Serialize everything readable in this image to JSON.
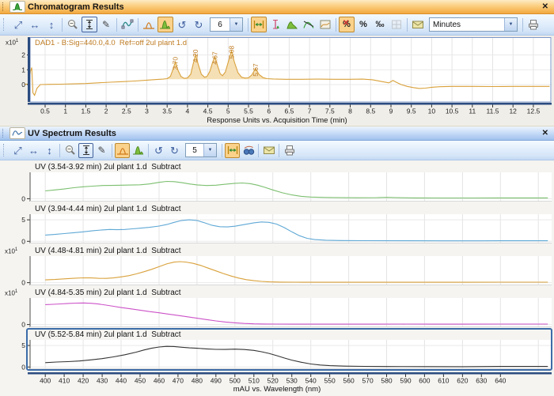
{
  "icons": {
    "expand_diag": "⤢",
    "expand_h": "↔",
    "expand_v": "↕",
    "undo": "↺",
    "redo": "↻",
    "dropdown_arrow": "▼",
    "close": "✕",
    "brush": "✎",
    "percent": "%",
    "cross": "✕",
    "permille": "‰"
  },
  "chromatogram_panel": {
    "title": "Chromatogram Results",
    "toolbar": {
      "zoom_value": "6",
      "unit_value": "Minutes"
    },
    "signal_label": "DAD1 - B:Sig=440.0,4.0  Ref=off 2ul plant 1.d",
    "y_exp_base": "x10",
    "y_exp_sup": "1",
    "axis_title": "Response Units vs. Acquisition Time (min)"
  },
  "uv_panel": {
    "title": "UV Spectrum Results",
    "toolbar": {
      "zoom_value": "5"
    },
    "y_exp_base": "x10",
    "y_exp_sup": "1",
    "axis_title": "mAU vs. Wavelength (nm)"
  },
  "chart_data": [
    {
      "id": "chrom",
      "type": "line",
      "title": "DAD1 - B:Sig=440.0,4.0  Ref=off 2ul plant 1.d",
      "xlabel": "Response Units vs. Acquisition Time (min)",
      "color": "#D9A13B",
      "fill_color": "#F5DFB5",
      "fill_range": [
        3.5,
        5.95
      ],
      "fill_base": 0.36,
      "xlim": [
        0.13,
        12.95
      ],
      "ylim": [
        -1.17,
        3.2
      ],
      "yticks": [
        0,
        1,
        2
      ],
      "xticks": {
        "start": 0.5,
        "end": 12.5,
        "step": 0.5
      },
      "frame": "chrom",
      "axis_strip": true,
      "peaks": [
        {
          "t": 3.7,
          "apex": 1.52,
          "label": "3.70"
        },
        {
          "t": 4.2,
          "apex": 2.02,
          "label": "4.20"
        },
        {
          "t": 4.67,
          "apex": 1.88,
          "label": "4.67"
        },
        {
          "t": 5.08,
          "apex": 2.28,
          "label": "5.08"
        },
        {
          "t": 5.67,
          "apex": 1.08,
          "label": "5.67"
        }
      ],
      "points": [
        [
          0.0,
          0.02
        ],
        [
          0.1,
          0.04
        ],
        [
          0.14,
          0.9
        ],
        [
          0.17,
          1.15
        ],
        [
          0.2,
          -0.55
        ],
        [
          0.24,
          -0.72
        ],
        [
          0.3,
          -0.25
        ],
        [
          0.38,
          0.0
        ],
        [
          0.6,
          0.02
        ],
        [
          0.9,
          0.03
        ],
        [
          1.2,
          0.05
        ],
        [
          1.5,
          0.07
        ],
        [
          1.8,
          0.12
        ],
        [
          2.1,
          0.16
        ],
        [
          2.4,
          0.2
        ],
        [
          2.7,
          0.24
        ],
        [
          3.0,
          0.3
        ],
        [
          3.2,
          0.34
        ],
        [
          3.4,
          0.37
        ],
        [
          3.5,
          0.4
        ],
        [
          3.58,
          0.55
        ],
        [
          3.64,
          1.0
        ],
        [
          3.7,
          1.52
        ],
        [
          3.76,
          1.0
        ],
        [
          3.84,
          0.55
        ],
        [
          3.92,
          0.42
        ],
        [
          4.0,
          0.45
        ],
        [
          4.08,
          0.7
        ],
        [
          4.14,
          1.4
        ],
        [
          4.2,
          2.02
        ],
        [
          4.26,
          1.4
        ],
        [
          4.34,
          0.7
        ],
        [
          4.42,
          0.5
        ],
        [
          4.48,
          0.55
        ],
        [
          4.55,
          0.9
        ],
        [
          4.61,
          1.45
        ],
        [
          4.67,
          1.88
        ],
        [
          4.73,
          1.35
        ],
        [
          4.8,
          0.75
        ],
        [
          4.86,
          0.6
        ],
        [
          4.93,
          0.85
        ],
        [
          5.0,
          1.5
        ],
        [
          5.08,
          2.28
        ],
        [
          5.15,
          1.55
        ],
        [
          5.24,
          0.8
        ],
        [
          5.33,
          0.5
        ],
        [
          5.42,
          0.44
        ],
        [
          5.5,
          0.46
        ],
        [
          5.58,
          0.65
        ],
        [
          5.67,
          1.08
        ],
        [
          5.76,
          0.68
        ],
        [
          5.86,
          0.47
        ],
        [
          5.95,
          0.4
        ],
        [
          6.1,
          0.38
        ],
        [
          6.4,
          0.36
        ],
        [
          6.8,
          0.36
        ],
        [
          7.2,
          0.37
        ],
        [
          7.6,
          0.36
        ],
        [
          8.0,
          0.36
        ],
        [
          8.3,
          0.37
        ],
        [
          8.55,
          0.33
        ],
        [
          8.75,
          0.22
        ],
        [
          8.95,
          0.12
        ],
        [
          9.05,
          0.28
        ],
        [
          9.12,
          0.18
        ],
        [
          9.25,
          0.0
        ],
        [
          9.4,
          -0.12
        ],
        [
          9.55,
          -0.2
        ],
        [
          9.7,
          -0.26
        ],
        [
          9.85,
          -0.24
        ],
        [
          10.0,
          -0.18
        ],
        [
          10.2,
          -0.14
        ],
        [
          10.5,
          -0.12
        ],
        [
          11.0,
          -0.12
        ],
        [
          11.5,
          -0.13
        ],
        [
          12.0,
          -0.12
        ],
        [
          12.5,
          -0.12
        ],
        [
          12.9,
          -0.12
        ]
      ]
    },
    {
      "id": "spec1",
      "type": "line",
      "label": "UV (3.54-3.92 min) 2ul plant 1.d  Subtract",
      "color": "#7CBF6F",
      "xlim": [
        392,
        667
      ],
      "ylim": [
        -0.45,
        4.2
      ],
      "yticks": [
        0
      ],
      "xticks": {
        "start": 400,
        "end": 640,
        "step": 10
      },
      "grid": {
        "start": 400,
        "end": 660,
        "step": 20
      },
      "points": [
        [
          400,
          1.25
        ],
        [
          405,
          1.4
        ],
        [
          410,
          1.55
        ],
        [
          415,
          1.75
        ],
        [
          420,
          1.9
        ],
        [
          425,
          2.0
        ],
        [
          430,
          2.1
        ],
        [
          435,
          2.12
        ],
        [
          440,
          2.15
        ],
        [
          445,
          2.18
        ],
        [
          450,
          2.22
        ],
        [
          455,
          2.35
        ],
        [
          460,
          2.6
        ],
        [
          464,
          2.75
        ],
        [
          468,
          2.72
        ],
        [
          472,
          2.55
        ],
        [
          476,
          2.35
        ],
        [
          480,
          2.2
        ],
        [
          485,
          2.1
        ],
        [
          490,
          2.15
        ],
        [
          495,
          2.3
        ],
        [
          500,
          2.45
        ],
        [
          504,
          2.5
        ],
        [
          508,
          2.4
        ],
        [
          512,
          2.15
        ],
        [
          516,
          1.8
        ],
        [
          520,
          1.4
        ],
        [
          525,
          0.95
        ],
        [
          530,
          0.6
        ],
        [
          535,
          0.38
        ],
        [
          540,
          0.27
        ],
        [
          548,
          0.2
        ],
        [
          556,
          0.17
        ],
        [
          565,
          0.15
        ],
        [
          575,
          0.17
        ],
        [
          580,
          0.22
        ],
        [
          585,
          0.17
        ],
        [
          595,
          0.13
        ],
        [
          610,
          0.12
        ],
        [
          625,
          0.12
        ],
        [
          640,
          0.13
        ],
        [
          665,
          0.13
        ]
      ]
    },
    {
      "id": "spec2",
      "type": "line",
      "label": "UV (3.94-4.44 min) 2ul plant 1.d  Subtract",
      "color": "#5FA8D5",
      "xlim": [
        392,
        667
      ],
      "ylim": [
        -0.5,
        6.3
      ],
      "yticks": [
        0,
        5
      ],
      "xticks": {
        "start": 400,
        "end": 640,
        "step": 10
      },
      "grid": {
        "start": 400,
        "end": 660,
        "step": 20
      },
      "points": [
        [
          400,
          1.45
        ],
        [
          405,
          1.6
        ],
        [
          410,
          1.8
        ],
        [
          415,
          2.0
        ],
        [
          420,
          2.2
        ],
        [
          425,
          2.45
        ],
        [
          430,
          2.65
        ],
        [
          434,
          2.75
        ],
        [
          438,
          2.7
        ],
        [
          442,
          2.75
        ],
        [
          446,
          2.9
        ],
        [
          450,
          3.05
        ],
        [
          455,
          3.25
        ],
        [
          460,
          3.55
        ],
        [
          464,
          3.9
        ],
        [
          468,
          4.4
        ],
        [
          472,
          4.85
        ],
        [
          476,
          5.0
        ],
        [
          480,
          4.85
        ],
        [
          484,
          4.3
        ],
        [
          488,
          3.7
        ],
        [
          492,
          3.4
        ],
        [
          496,
          3.35
        ],
        [
          500,
          3.5
        ],
        [
          505,
          3.9
        ],
        [
          510,
          4.3
        ],
        [
          514,
          4.5
        ],
        [
          518,
          4.4
        ],
        [
          522,
          4.0
        ],
        [
          526,
          3.2
        ],
        [
          530,
          2.2
        ],
        [
          534,
          1.3
        ],
        [
          538,
          0.7
        ],
        [
          542,
          0.4
        ],
        [
          548,
          0.25
        ],
        [
          556,
          0.18
        ],
        [
          570,
          0.14
        ],
        [
          590,
          0.12
        ],
        [
          610,
          0.1
        ],
        [
          630,
          0.1
        ],
        [
          640,
          0.12
        ],
        [
          665,
          0.12
        ]
      ]
    },
    {
      "id": "spec3",
      "type": "line",
      "label": "UV (4.48-4.81 min) 2ul plant 1.d  Subtract",
      "color": "#D9A13B",
      "y_exp": true,
      "xlim": [
        392,
        667
      ],
      "ylim": [
        -0.45,
        4.4
      ],
      "yticks": [
        0
      ],
      "xticks": {
        "start": 400,
        "end": 640,
        "step": 10
      },
      "grid": {
        "start": 400,
        "end": 660,
        "step": 20
      },
      "points": [
        [
          400,
          0.45
        ],
        [
          405,
          0.52
        ],
        [
          410,
          0.62
        ],
        [
          415,
          0.72
        ],
        [
          420,
          0.8
        ],
        [
          424,
          0.78
        ],
        [
          428,
          0.72
        ],
        [
          432,
          0.7
        ],
        [
          436,
          0.78
        ],
        [
          440,
          0.95
        ],
        [
          444,
          1.15
        ],
        [
          448,
          1.45
        ],
        [
          452,
          1.8
        ],
        [
          456,
          2.2
        ],
        [
          460,
          2.65
        ],
        [
          464,
          3.1
        ],
        [
          468,
          3.4
        ],
        [
          471,
          3.48
        ],
        [
          474,
          3.42
        ],
        [
          478,
          3.2
        ],
        [
          482,
          2.85
        ],
        [
          486,
          2.4
        ],
        [
          490,
          1.95
        ],
        [
          494,
          1.5
        ],
        [
          498,
          1.1
        ],
        [
          502,
          0.75
        ],
        [
          506,
          0.5
        ],
        [
          510,
          0.32
        ],
        [
          514,
          0.2
        ],
        [
          518,
          0.13
        ],
        [
          524,
          0.09
        ],
        [
          532,
          0.07
        ],
        [
          545,
          0.06
        ],
        [
          560,
          0.06
        ],
        [
          580,
          0.06
        ],
        [
          600,
          0.06
        ],
        [
          620,
          0.06
        ],
        [
          640,
          0.07
        ],
        [
          665,
          0.07
        ]
      ]
    },
    {
      "id": "spec4",
      "type": "line",
      "label": "UV (4.84-5.35 min) 2ul plant 1.d  Subtract",
      "color": "#CC52C8",
      "y_exp": true,
      "xlim": [
        392,
        667
      ],
      "ylim": [
        -0.45,
        4.4
      ],
      "yticks": [
        0
      ],
      "xticks": {
        "start": 400,
        "end": 640,
        "step": 10
      },
      "grid": {
        "start": 400,
        "end": 660,
        "step": 20
      },
      "points": [
        [
          400,
          3.3
        ],
        [
          404,
          3.35
        ],
        [
          408,
          3.42
        ],
        [
          412,
          3.5
        ],
        [
          416,
          3.55
        ],
        [
          420,
          3.58
        ],
        [
          424,
          3.52
        ],
        [
          428,
          3.4
        ],
        [
          432,
          3.22
        ],
        [
          436,
          3.02
        ],
        [
          440,
          2.82
        ],
        [
          445,
          2.6
        ],
        [
          450,
          2.38
        ],
        [
          455,
          2.15
        ],
        [
          460,
          1.95
        ],
        [
          465,
          1.72
        ],
        [
          470,
          1.5
        ],
        [
          475,
          1.28
        ],
        [
          480,
          1.05
        ],
        [
          485,
          0.82
        ],
        [
          490,
          0.6
        ],
        [
          495,
          0.42
        ],
        [
          500,
          0.28
        ],
        [
          505,
          0.18
        ],
        [
          510,
          0.12
        ],
        [
          515,
          0.09
        ],
        [
          522,
          0.07
        ],
        [
          530,
          0.06
        ],
        [
          545,
          0.06
        ],
        [
          560,
          0.06
        ],
        [
          575,
          0.06
        ],
        [
          590,
          0.07
        ],
        [
          605,
          0.06
        ],
        [
          620,
          0.06
        ],
        [
          640,
          0.07
        ],
        [
          665,
          0.07
        ]
      ]
    },
    {
      "id": "spec5",
      "type": "line",
      "label": "UV (5.52-5.84 min) 2ul plant 1.d  Subtract",
      "color": "#333333",
      "selected": true,
      "xlim": [
        392,
        667
      ],
      "ylim": [
        -0.5,
        6.3
      ],
      "yticks": [
        0,
        5
      ],
      "xticks": {
        "start": 400,
        "end": 640,
        "step": 10
      },
      "grid": {
        "start": 400,
        "end": 660,
        "step": 20
      },
      "points": [
        [
          400,
          1.0
        ],
        [
          406,
          1.15
        ],
        [
          412,
          1.25
        ],
        [
          418,
          1.4
        ],
        [
          424,
          1.65
        ],
        [
          430,
          1.95
        ],
        [
          436,
          2.35
        ],
        [
          442,
          2.85
        ],
        [
          448,
          3.45
        ],
        [
          452,
          3.95
        ],
        [
          456,
          4.35
        ],
        [
          460,
          4.65
        ],
        [
          464,
          4.8
        ],
        [
          468,
          4.75
        ],
        [
          472,
          4.6
        ],
        [
          476,
          4.45
        ],
        [
          480,
          4.35
        ],
        [
          485,
          4.2
        ],
        [
          490,
          4.1
        ],
        [
          495,
          4.08
        ],
        [
          500,
          4.15
        ],
        [
          505,
          4.05
        ],
        [
          510,
          3.85
        ],
        [
          514,
          3.55
        ],
        [
          518,
          3.15
        ],
        [
          522,
          2.65
        ],
        [
          526,
          2.1
        ],
        [
          530,
          1.6
        ],
        [
          535,
          1.1
        ],
        [
          540,
          0.7
        ],
        [
          545,
          0.45
        ],
        [
          550,
          0.3
        ],
        [
          558,
          0.2
        ],
        [
          568,
          0.14
        ],
        [
          580,
          0.11
        ],
        [
          600,
          0.09
        ],
        [
          620,
          0.07
        ],
        [
          640,
          0.12
        ],
        [
          665,
          0.12
        ]
      ]
    },
    {
      "id": "specaxis",
      "type": "axis",
      "axis_only": true,
      "xlabel": "mAU vs. Wavelength (nm)",
      "xlim": [
        392,
        667
      ],
      "xticks": {
        "start": 400,
        "end": 640,
        "step": 10
      }
    }
  ]
}
